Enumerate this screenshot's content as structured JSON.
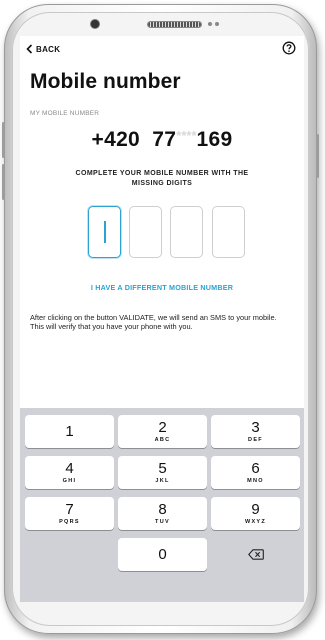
{
  "header": {
    "back_label": "BACK",
    "help_icon": "help-circle-icon"
  },
  "page": {
    "title": "Mobile number",
    "field_label": "MY MOBILE NUMBER",
    "phone_prefix": "+420  77",
    "phone_mask": "****",
    "phone_suffix": "169",
    "instruction": "COMPLETE YOUR MOBILE NUMBER WITH THE MISSING DIGITS",
    "digit_values": [
      "",
      "",
      "",
      ""
    ],
    "different_number_link": "I HAVE A DIFFERENT MOBILE NUMBER",
    "info_line_1": "After clicking on the button VALIDATE, we will send an SMS to your mobile.",
    "info_line_2": "This will verify that you have your phone with you."
  },
  "keypad": {
    "keys": [
      {
        "num": "1",
        "letters": ""
      },
      {
        "num": "2",
        "letters": "ABC"
      },
      {
        "num": "3",
        "letters": "DEF"
      },
      {
        "num": "4",
        "letters": "GHI"
      },
      {
        "num": "5",
        "letters": "JKL"
      },
      {
        "num": "6",
        "letters": "MNO"
      },
      {
        "num": "7",
        "letters": "PQRS"
      },
      {
        "num": "8",
        "letters": "TUV"
      },
      {
        "num": "9",
        "letters": "WXYZ"
      },
      {
        "num": "0",
        "letters": ""
      }
    ],
    "backspace_icon": "backspace-icon"
  },
  "colors": {
    "accent": "#2aa3d4",
    "keypad_bg": "#d0d1d6"
  }
}
